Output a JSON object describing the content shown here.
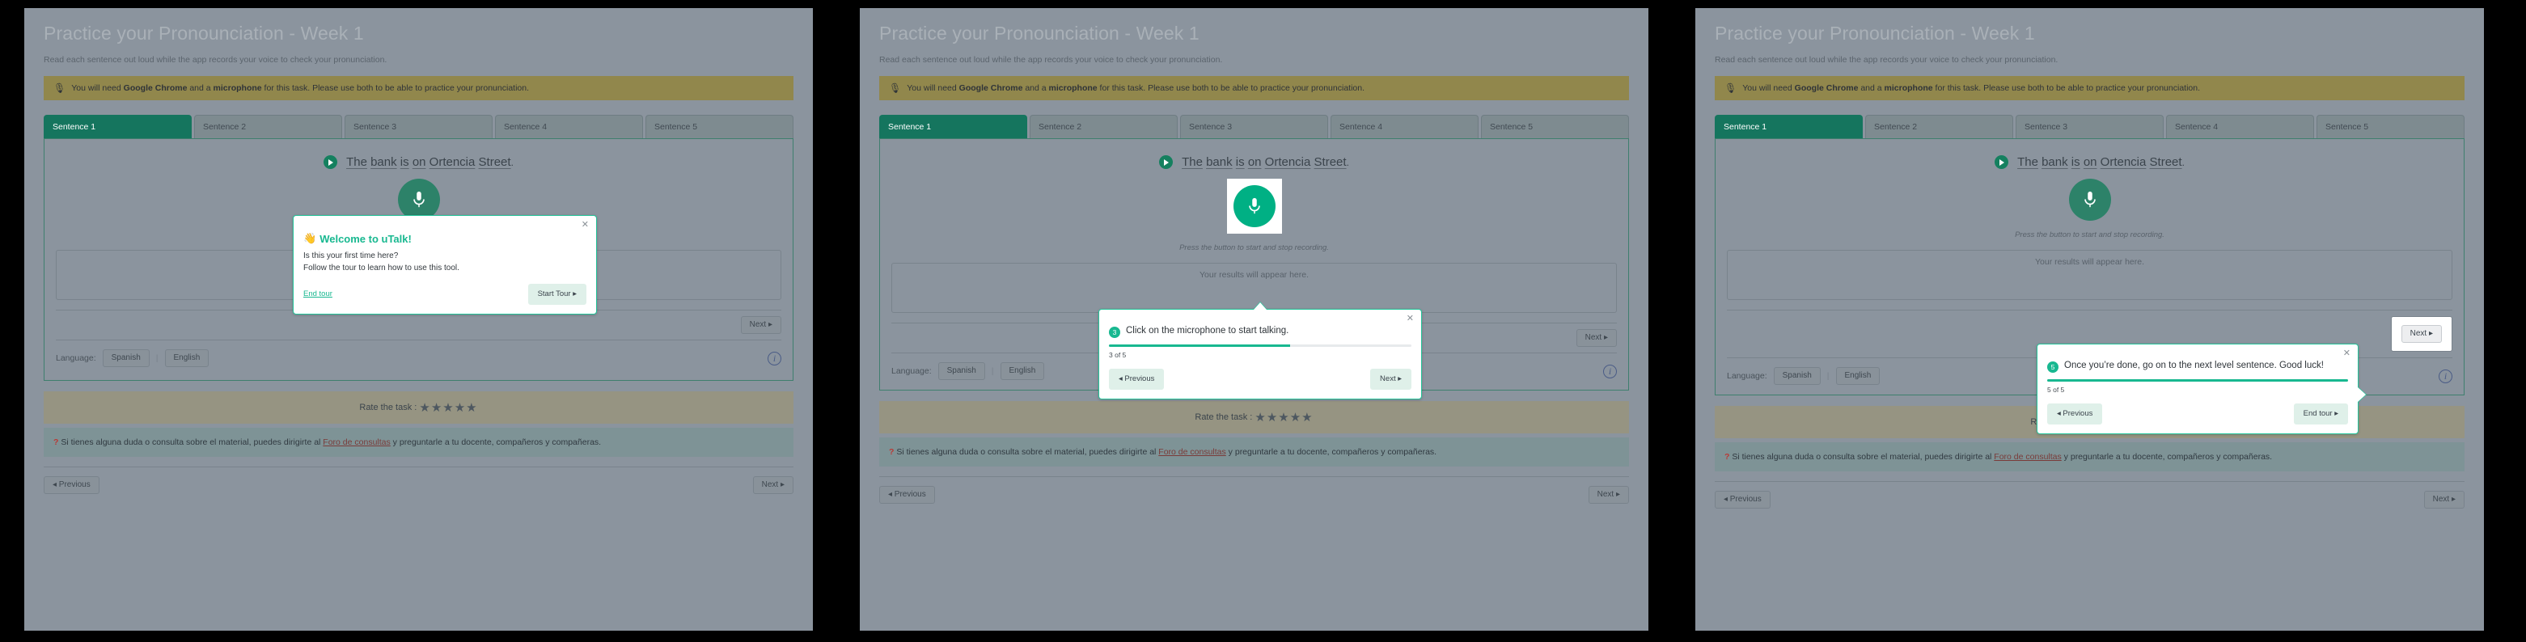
{
  "page": {
    "title": "Practice your Pronounciation - Week 1",
    "subtitle": "Read each sentence out loud while the app records your voice to check your pronunciation.",
    "notice": {
      "icon": "microphone-icon",
      "prefix": "You will need ",
      "bold1": "Google Chrome",
      "mid": " and a ",
      "bold2": "microphone",
      "suffix": " for this task. Please use both to be able to practice your pronunciation."
    }
  },
  "tabs": [
    {
      "label": "Sentence 1",
      "active": true
    },
    {
      "label": "Sentence 2",
      "active": false
    },
    {
      "label": "Sentence 3",
      "active": false
    },
    {
      "label": "Sentence 4",
      "active": false
    },
    {
      "label": "Sentence 5",
      "active": false
    }
  ],
  "exercise": {
    "play_icon": "play-circle-icon",
    "sentence_words": [
      "The",
      "bank",
      "is",
      "on",
      "Ortencia",
      "Street"
    ],
    "sentence_punct": ".",
    "mic_icon": "microphone-icon",
    "press_hint": "Press the button to start and stop recording.",
    "results_placeholder": "Your results will appear here.",
    "next_label": "Next ▸",
    "language_label": "Language:",
    "language_options": [
      "Spanish",
      "English"
    ],
    "info_icon": "info-icon",
    "info_glyph": "i"
  },
  "rating": {
    "label": "Rate the task :",
    "stars": "★★★★★",
    "count": 5
  },
  "help": {
    "marker": "?",
    "text_before": " Si tienes alguna duda o consulta sobre el material, puedes dirigirte al ",
    "link": "Foro de consultas",
    "text_after": " y preguntarle a tu docente, compañeros y compañeras."
  },
  "footer": {
    "previous_label": "◂ Previous",
    "next_label": "Next ▸"
  },
  "tour": {
    "welcome": {
      "close_icon": "close-icon",
      "wave_icon": "waving-hand-icon",
      "wave_glyph": "👋",
      "title": "Welcome to uTalk!",
      "line1": "Is this your first time here?",
      "line2": "Follow the tour to learn how to use this tool.",
      "end_tour_label": "End tour",
      "start_tour_label": "Start Tour ▸"
    },
    "step3": {
      "close_icon": "close-icon",
      "number": "3",
      "text": "Click on the microphone to start talking.",
      "progress_percent": 60,
      "progress_label": "3 of 5",
      "previous_label": "◂ Previous",
      "next_label": "Next ▸"
    },
    "step5": {
      "close_icon": "close-icon",
      "number": "5",
      "text": "Once you’re done, go on to the next level sentence. Good luck!",
      "progress_percent": 100,
      "progress_label": "5 of 5",
      "previous_label": "◂ Previous",
      "end_tour_label": "End tour ▸"
    }
  },
  "colors": {
    "accent_green": "#18b890",
    "tab_active": "#15755e",
    "notice_bg": "#91874c",
    "help_bg": "#7e9396",
    "rating_bg": "#969482",
    "page_bg": "#8b949e"
  }
}
